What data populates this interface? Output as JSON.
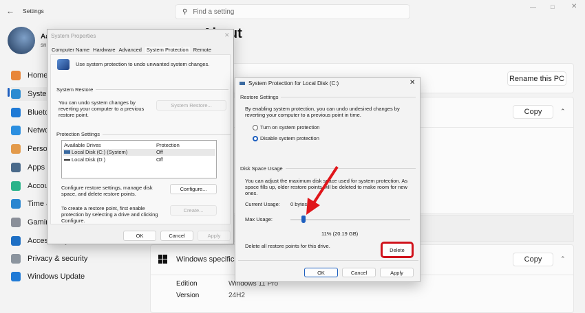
{
  "settings": {
    "app_title": "Settings",
    "search_placeholder": "Find a setting",
    "profile": {
      "name_fragment": "Aa",
      "email_fragment": "sn"
    },
    "page_title": "About",
    "nav": [
      {
        "label": "Home",
        "color": "#e8863a"
      },
      {
        "label": "System",
        "color": "#2a8bd1"
      },
      {
        "label": "Bluetooth & devices",
        "color": "#1f7ad6"
      },
      {
        "label": "Network & internet",
        "color": "#2b8fe0"
      },
      {
        "label": "Personalization",
        "color": "#e39a4a"
      },
      {
        "label": "Apps",
        "color": "#4a6a8a"
      },
      {
        "label": "Accounts",
        "color": "#2bb38a"
      },
      {
        "label": "Time & language",
        "color": "#2a86d0"
      },
      {
        "label": "Gaming",
        "color": "#8a8f99"
      },
      {
        "label": "Accessibility",
        "color": "#1e6fc4"
      },
      {
        "label": "Privacy & security",
        "color": "#8b949e"
      },
      {
        "label": "Windows Update",
        "color": "#1f7ad6"
      }
    ],
    "rename_button": "Rename this PC",
    "copy_button": "Copy",
    "windows_spec_title": "Windows specifications",
    "specs": [
      {
        "label": "Edition",
        "value": "Windows 11 Pro"
      },
      {
        "label": "Version",
        "value": "24H2"
      }
    ]
  },
  "sysprops": {
    "title": "System Properties",
    "tabs": [
      "Computer Name",
      "Hardware",
      "Advanced",
      "System Protection",
      "Remote"
    ],
    "active_tab": "System Protection",
    "intro": "Use system protection to undo unwanted system changes.",
    "restore_group": "System Restore",
    "restore_text": "You can undo system changes by reverting your computer to a previous restore point.",
    "restore_button": "System Restore...",
    "protection_group": "Protection Settings",
    "columns": [
      "Available Drives",
      "Protection"
    ],
    "drives": [
      {
        "name": "Local Disk (C:) (System)",
        "protection": "Off"
      },
      {
        "name": "Local Disk (D:)",
        "protection": "Off"
      }
    ],
    "configure_text": "Configure restore settings, manage disk space, and delete restore points.",
    "configure_button": "Configure...",
    "create_text": "To create a restore point, first enable protection by selecting a drive and clicking Configure.",
    "create_button": "Create...",
    "ok": "OK",
    "cancel": "Cancel",
    "apply": "Apply"
  },
  "protection": {
    "title": "System Protection for Local Disk (C:)",
    "restore_settings": "Restore Settings",
    "restore_desc": "By enabling system protection, you can undo undesired changes by reverting your computer to a previous point in time.",
    "option_on": "Turn on system protection",
    "option_off": "Disable system protection",
    "selected": "Disable system protection",
    "disk_usage": "Disk Space Usage",
    "disk_desc": "You can adjust the maximum disk space used for system protection. As space fills up, older restore points will be deleted to make room for new ones.",
    "current_label": "Current Usage:",
    "current_value": "0 bytes",
    "max_label": "Max Usage:",
    "max_percent": 11,
    "max_value": "11% (20.19 GB)",
    "delete_text": "Delete all restore points for this drive.",
    "delete_button": "Delete",
    "ok": "OK",
    "cancel": "Cancel",
    "apply": "Apply",
    "highlight_color": "#d0121b"
  }
}
